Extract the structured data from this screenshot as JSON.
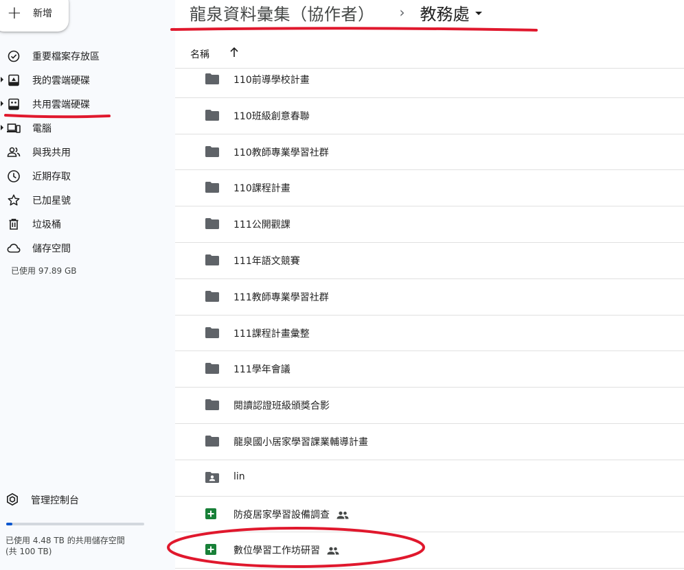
{
  "sidebar": {
    "new_label": "新增",
    "items": [
      {
        "label": "重要檔案存放區",
        "icon": "check-circle-icon",
        "expandable": false
      },
      {
        "label": "我的雲端硬碟",
        "icon": "my-drive-icon",
        "expandable": true
      },
      {
        "label": "共用雲端硬碟",
        "icon": "shared-drives-icon",
        "expandable": true
      },
      {
        "label": "電腦",
        "icon": "computers-icon",
        "expandable": true
      },
      {
        "label": "與我共用",
        "icon": "people-icon",
        "expandable": false
      },
      {
        "label": "近期存取",
        "icon": "clock-icon",
        "expandable": false
      },
      {
        "label": "已加星號",
        "icon": "star-icon",
        "expandable": false
      },
      {
        "label": "垃圾桶",
        "icon": "trash-icon",
        "expandable": false
      },
      {
        "label": "儲存空間",
        "icon": "cloud-icon",
        "expandable": false
      }
    ],
    "storage_used": "已使用 97.89 GB",
    "admin_label": "管理控制台",
    "quota_fraction": 0.045,
    "quota_line1": "已使用 4.48 TB 的共用儲存空間",
    "quota_line2": "(共 100 TB)"
  },
  "header": {
    "breadcrumb_root": "龍泉資料彙集（協作者）",
    "breadcrumb_separator": "›",
    "breadcrumb_current": "教務處"
  },
  "list": {
    "column_name": "名稱",
    "sort": "ascending",
    "files": [
      {
        "name": "110前導學校計畫",
        "type": "folder",
        "shared": false
      },
      {
        "name": "110班級創意春聯",
        "type": "folder",
        "shared": false
      },
      {
        "name": "110教師專業學習社群",
        "type": "folder",
        "shared": false
      },
      {
        "name": "110課程計畫",
        "type": "folder",
        "shared": false
      },
      {
        "name": "111公開觀課",
        "type": "folder",
        "shared": false
      },
      {
        "name": "111年語文競賽",
        "type": "folder",
        "shared": false
      },
      {
        "name": "111教師專業學習社群",
        "type": "folder",
        "shared": false
      },
      {
        "name": "111課程計畫彙整",
        "type": "folder",
        "shared": false
      },
      {
        "name": "111學年會議",
        "type": "folder",
        "shared": false
      },
      {
        "name": "閱讀認證班級頒獎合影",
        "type": "folder",
        "shared": false
      },
      {
        "name": "龍泉國小居家學習課業輔導計畫",
        "type": "folder",
        "shared": false
      },
      {
        "name": "lin",
        "type": "shared-folder",
        "shared": false
      },
      {
        "name": "防疫居家學習設備調查",
        "type": "sheet",
        "shared": true
      },
      {
        "name": "數位學習工作坊研習",
        "type": "sheet",
        "shared": true
      }
    ]
  },
  "colors": {
    "accent": "#0b57d0",
    "annotation_red": "#e0182d",
    "folder_gray": "#5f6368",
    "sheets_green": "#188038"
  }
}
